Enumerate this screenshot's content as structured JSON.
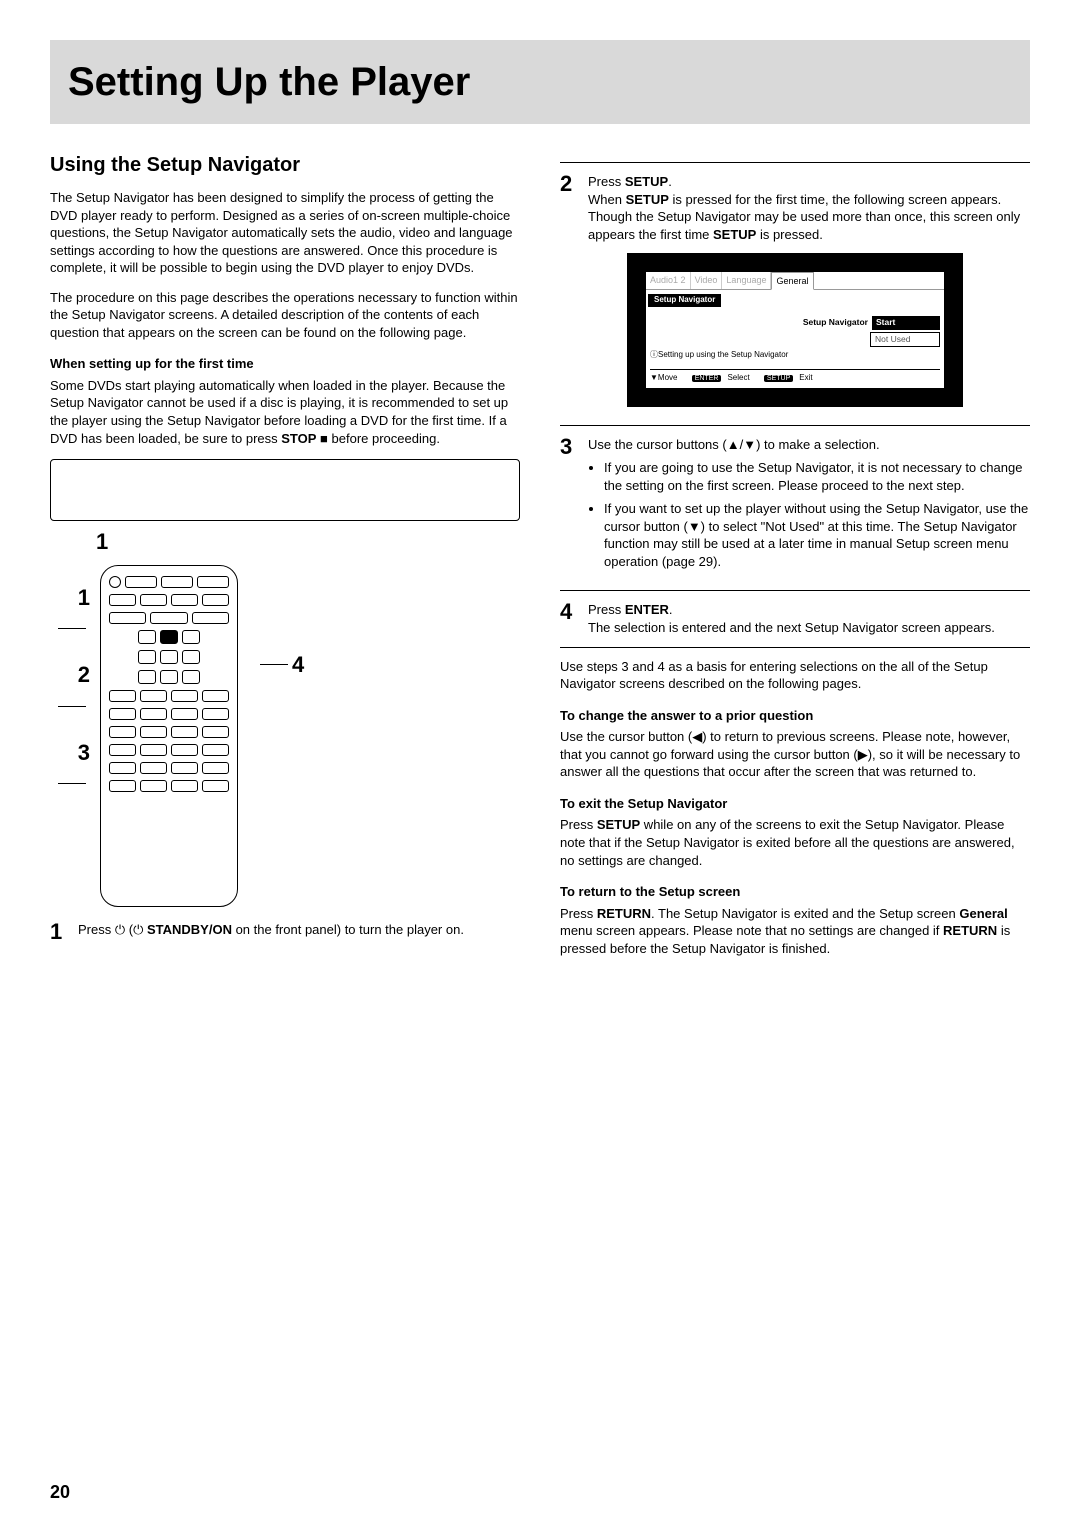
{
  "chapterTitle": "Setting Up the Player",
  "pageNumber": "20",
  "left": {
    "sectionHeading": "Using the Setup Navigator",
    "intro1": "The Setup Navigator has been designed to simplify the process of getting the DVD player ready to perform. Designed as a series of on-screen multiple-choice questions, the Setup Navigator automatically sets the audio, video and language settings according to how the questions are answered. Once this procedure is complete, it will be possible to begin using the DVD player to enjoy DVDs.",
    "intro2": "The procedure on this page describes the operations necessary to function within the Setup Navigator screens. A detailed description of the contents of each question that appears on the screen can be found on the following page.",
    "firstTimeHeading": "When setting up for the first time",
    "firstTimeBody_a": "Some DVDs start playing automatically when loaded in the player. Because the Setup Navigator cannot be used if a disc is playing, it is recommended to set up the player using the Setup Navigator before loading a DVD for the first time. If a DVD has been loaded, be sure to press ",
    "firstTimeBody_stop": "STOP",
    "firstTimeBody_b": " ■ before proceeding.",
    "playerCallout": "1",
    "remoteLabels": {
      "a": "1",
      "b": "2",
      "c": "3",
      "d": "4"
    },
    "step1Num": "1",
    "step1_a": "Press ",
    "step1_standby": "STANDBY/ON",
    "step1_b": " on the front panel) to turn the player on."
  },
  "right": {
    "step2Num": "2",
    "step2Lead_a": "Press ",
    "step2Lead_b": "SETUP",
    "step2Lead_c": ".",
    "step2Body_a": "When ",
    "step2Body_b": "SETUP",
    "step2Body_c": " is pressed for the first time, the following screen appears. Though the Setup Navigator may be used more than once, this screen only appears the first time ",
    "step2Body_d": "SETUP",
    "step2Body_e": " is pressed.",
    "osd": {
      "tabs": {
        "a": "Audio1",
        "b": "2",
        "c": "Video",
        "d": "Language",
        "e": "General"
      },
      "crumb": "Setup Navigator",
      "rowLabel": "Setup Navigator",
      "optStart": "Start",
      "optNotUsed": "Not Used",
      "hint": "Setting up using the Setup Navigator",
      "footerMove": "Move",
      "footerSelectKey": "ENTER",
      "footerSelect": "Select",
      "footerExitKey": "SETUP",
      "footerExit": "Exit"
    },
    "step3Num": "3",
    "step3Lead": "Use the cursor buttons (▲/▼) to make a selection.",
    "step3Bul1": "If you are going to use the Setup Navigator, it is not necessary to change the setting on the first screen. Please proceed to the next step.",
    "step3Bul2": "If you want to set up the player without using the Setup Navigator, use the cursor button (▼) to select \"Not Used\" at this time. The Setup Navigator function may still be used at a later time in manual Setup screen menu operation (page 29).",
    "step4Num": "4",
    "step4Lead_a": "Press ",
    "step4Lead_b": "ENTER",
    "step4Lead_c": ".",
    "step4Body": "The selection is entered and the next Setup Navigator screen appears.",
    "afterSteps": "Use steps 3 and 4 as a basis for entering selections on the all of the Setup Navigator screens described on the following pages.",
    "changeHeading": "To change the answer to a prior question",
    "changeBody": "Use the cursor button (◀) to return to previous screens. Please note, however, that you cannot go forward using the cursor button (▶), so it will be necessary to answer all the questions that occur after the screen that was returned to.",
    "exitHeading": "To exit the Setup Navigator",
    "exitBody_a": "Press ",
    "exitBody_b": "SETUP",
    "exitBody_c": " while  on any of the screens to exit the Setup Navigator. Please note that if the Setup Navigator is exited before all the questions are answered, no settings are changed.",
    "returnHeading": "To return to the Setup screen",
    "returnBody_a": "Press ",
    "returnBody_b": "RETURN",
    "returnBody_c": ". The Setup Navigator is exited and the Setup screen ",
    "returnBody_d": "General",
    "returnBody_e": " menu screen appears. Please note that no settings are changed if ",
    "returnBody_f": "RETURN",
    "returnBody_g": " is pressed before the Setup Navigator is finished."
  }
}
